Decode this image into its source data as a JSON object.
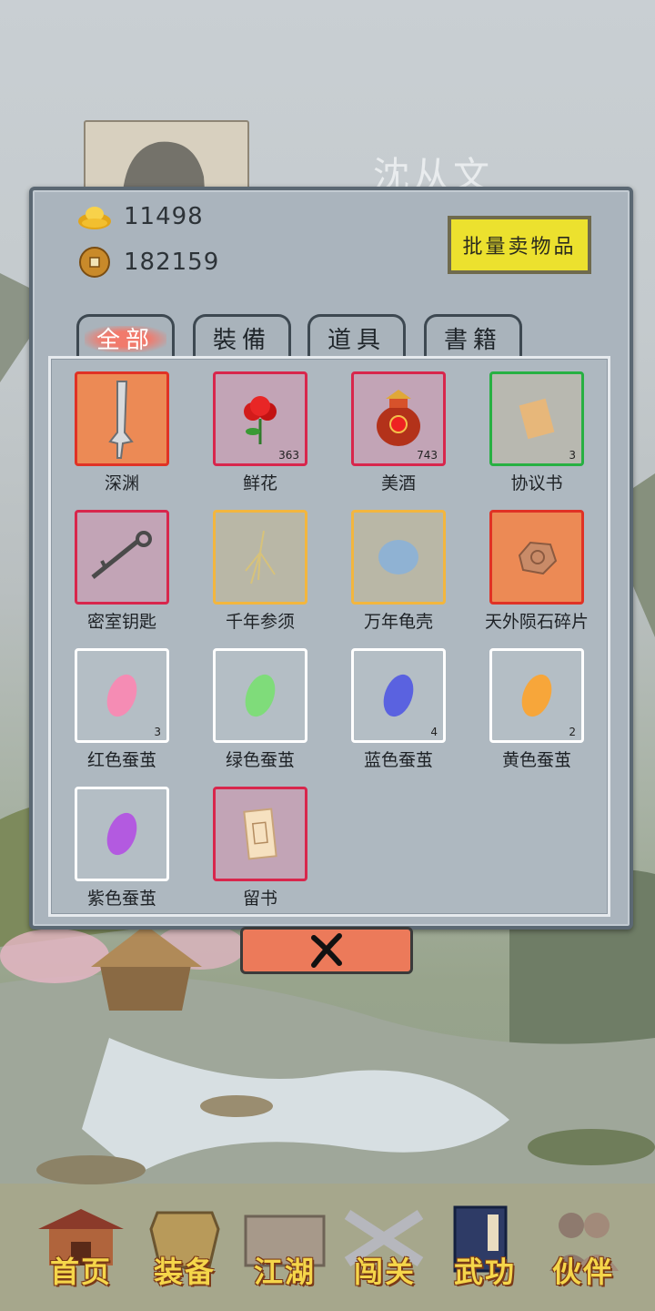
{
  "profile": {
    "name": "沈从文"
  },
  "currency": {
    "gold": "11498",
    "coins": "182159"
  },
  "sell_button": "批量卖物品",
  "tabs": [
    {
      "label": "全部",
      "active": true
    },
    {
      "label": "裝備",
      "active": false
    },
    {
      "label": "道具",
      "active": false
    },
    {
      "label": "書籍",
      "active": false
    }
  ],
  "items": [
    {
      "name": "深渊",
      "count": "",
      "quality": "orange",
      "icon": "sword-icon"
    },
    {
      "name": "鲜花",
      "count": "363",
      "quality": "red",
      "icon": "rose-icon"
    },
    {
      "name": "美酒",
      "count": "743",
      "quality": "red",
      "icon": "wine-jar-icon"
    },
    {
      "name": "协议书",
      "count": "3",
      "quality": "green",
      "icon": "scroll-icon"
    },
    {
      "name": "密室钥匙",
      "count": "",
      "quality": "red",
      "icon": "key-icon"
    },
    {
      "name": "千年参须",
      "count": "",
      "quality": "yellow",
      "icon": "ginseng-icon"
    },
    {
      "name": "万年龟壳",
      "count": "",
      "quality": "yellow",
      "icon": "turtle-shell-icon"
    },
    {
      "name": "天外陨石碎片",
      "count": "",
      "quality": "orange",
      "icon": "meteorite-icon"
    },
    {
      "name": "红色蚕茧",
      "count": "3",
      "quality": "white",
      "icon": "cocoon-icon",
      "color": "#f58cb4"
    },
    {
      "name": "绿色蚕茧",
      "count": "",
      "quality": "white",
      "icon": "cocoon-icon",
      "color": "#7fdc7a"
    },
    {
      "name": "蓝色蚕茧",
      "count": "4",
      "quality": "white",
      "icon": "cocoon-icon",
      "color": "#5a62e0"
    },
    {
      "name": "黄色蚕茧",
      "count": "2",
      "quality": "white",
      "icon": "cocoon-icon",
      "color": "#f7a63a"
    },
    {
      "name": "紫色蚕茧",
      "count": "",
      "quality": "white",
      "icon": "cocoon-icon",
      "color": "#b35ae0"
    },
    {
      "name": "留书",
      "count": "",
      "quality": "red",
      "icon": "letter-icon"
    }
  ],
  "nav": [
    {
      "label": "首页",
      "icon": "pavilion-icon"
    },
    {
      "label": "装备",
      "icon": "armor-icon"
    },
    {
      "label": "江湖",
      "icon": "map-scroll-icon"
    },
    {
      "label": "闯关",
      "icon": "crossed-swords-icon"
    },
    {
      "label": "武功",
      "icon": "manual-book-icon"
    },
    {
      "label": "伙伴",
      "icon": "companions-icon"
    }
  ]
}
